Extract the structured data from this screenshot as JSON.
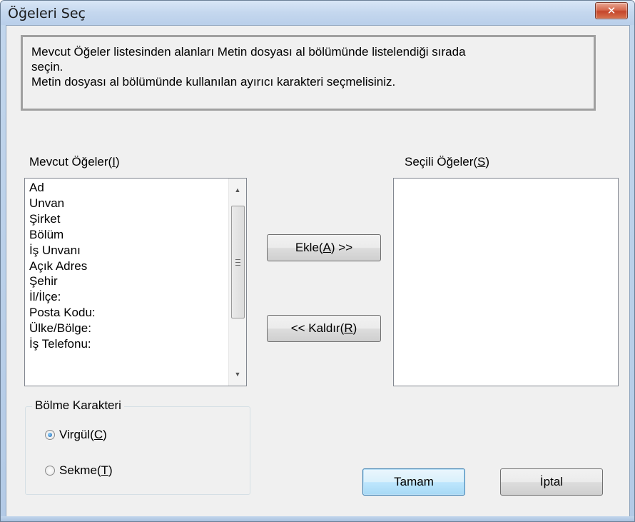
{
  "window": {
    "title": "Öğeleri Seç",
    "close_glyph": "✕"
  },
  "info": {
    "line1": "Mevcut Öğeler listesinden alanları Metin dosyası al bölümünde listelendiği sırada",
    "line2": "seçin.",
    "line3": "Metin dosyası al bölümünde kullanılan ayırıcı karakteri seçmelisiniz."
  },
  "available": {
    "label_prefix": "Mevcut Öğeler(",
    "label_key": "I",
    "label_suffix": ")",
    "items": [
      "Ad",
      "Unvan",
      "Şirket",
      "Bölüm",
      "İş Unvanı",
      "Açık Adres",
      "Şehir",
      "İl/İlçe:",
      "Posta Kodu:",
      "Ülke/Bölge:",
      "İş Telefonu:"
    ]
  },
  "selected": {
    "label_prefix": "Seçili Öğeler(",
    "label_key": "S",
    "label_suffix": ")",
    "items": []
  },
  "buttons": {
    "add_prefix": "Ekle(",
    "add_key": "A",
    "add_suffix": ") >>",
    "remove_prefix": "<< Kaldır(",
    "remove_key": "R",
    "remove_suffix": ")",
    "ok": "Tamam",
    "cancel": "İptal"
  },
  "separator": {
    "legend": "Bölme Karakteri",
    "comma_prefix": "Virgül(",
    "comma_key": "C",
    "comma_suffix": ")",
    "comma_checked": true,
    "tab_prefix": "Sekme(",
    "tab_key": "T",
    "tab_suffix": ")",
    "tab_checked": false
  },
  "colors": {
    "close_button": "#c4452b",
    "default_button_border": "#3c7fb1"
  },
  "icons": {
    "scroll_up": "▲",
    "scroll_down": "▼"
  }
}
